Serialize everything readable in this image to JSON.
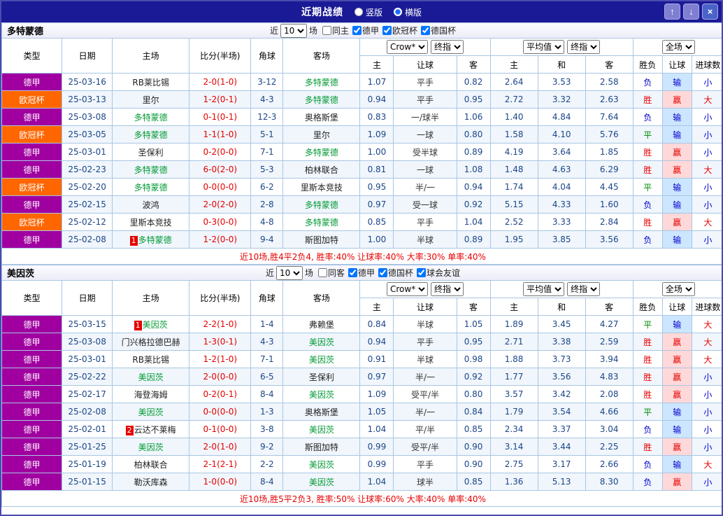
{
  "titlebar": {
    "title": "近期战绩",
    "vertical_label": "竖版",
    "horizontal_label": "横版",
    "up_icon": "↑",
    "down_icon": "↓",
    "close_icon": "×"
  },
  "table_header": {
    "type": "类型",
    "date": "日期",
    "home": "主场",
    "score": "比分(半场)",
    "corner": "角球",
    "away": "客场",
    "odds_select": "Crow*",
    "odds_final_select": "终指",
    "avg_select": "平均值",
    "avg_final_select": "终指",
    "scope_select": "全场",
    "sub": [
      "主",
      "让球",
      "客",
      "主",
      "和",
      "客",
      "胜负",
      "让球",
      "进球数"
    ]
  },
  "colors": {
    "league": {
      "德甲": "#A000A0",
      "欧冠杯": "#FF6600"
    },
    "result": {
      "胜": "#E60000",
      "平": "#008800",
      "负": "#0000CC"
    },
    "handicap_result": {
      "赢": {
        "fg": "#E60000",
        "bg": "#FFD9D9"
      },
      "输": {
        "fg": "#0000CC",
        "bg": "#CCE6FF"
      }
    },
    "goals": {
      "大": "#E60000",
      "小": "#0000CC"
    },
    "highlight_team": "#009933",
    "score": "#E60000"
  },
  "sections": [
    {
      "team": "多特蒙德",
      "filter": {
        "near": "近",
        "count": "10",
        "games": "场",
        "checkboxes": [
          {
            "label": "同主",
            "checked": false
          },
          {
            "label": "德甲",
            "checked": true
          },
          {
            "label": "欧冠杯",
            "checked": true
          },
          {
            "label": "德国杯",
            "checked": true
          }
        ]
      },
      "rows": [
        {
          "league": "德甲",
          "date": "25-03-16",
          "home": "RB莱比锡",
          "home_hl": false,
          "home_badge": "",
          "score": "2-0(1-0)",
          "corner": "3-12",
          "away": "多特蒙德",
          "away_hl": true,
          "away_badge": "",
          "odds": [
            "1.07",
            "平手",
            "0.82"
          ],
          "avg": [
            "2.64",
            "3.53",
            "2.58"
          ],
          "result": [
            "负",
            "输",
            "小"
          ]
        },
        {
          "league": "欧冠杯",
          "date": "25-03-13",
          "home": "里尔",
          "home_hl": false,
          "home_badge": "",
          "score": "1-2(0-1)",
          "corner": "4-3",
          "away": "多特蒙德",
          "away_hl": true,
          "away_badge": "",
          "odds": [
            "0.94",
            "平手",
            "0.95"
          ],
          "avg": [
            "2.72",
            "3.32",
            "2.63"
          ],
          "result": [
            "胜",
            "赢",
            "大"
          ]
        },
        {
          "league": "德甲",
          "date": "25-03-08",
          "home": "多特蒙德",
          "home_hl": true,
          "home_badge": "",
          "score": "0-1(0-1)",
          "corner": "12-3",
          "away": "奥格斯堡",
          "away_hl": false,
          "away_badge": "",
          "odds": [
            "0.83",
            "一/球半",
            "1.06"
          ],
          "avg": [
            "1.40",
            "4.84",
            "7.64"
          ],
          "result": [
            "负",
            "输",
            "小"
          ]
        },
        {
          "league": "欧冠杯",
          "date": "25-03-05",
          "home": "多特蒙德",
          "home_hl": true,
          "home_badge": "",
          "score": "1-1(1-0)",
          "corner": "5-1",
          "away": "里尔",
          "away_hl": false,
          "away_badge": "",
          "odds": [
            "1.09",
            "一球",
            "0.80"
          ],
          "avg": [
            "1.58",
            "4.10",
            "5.76"
          ],
          "result": [
            "平",
            "输",
            "小"
          ]
        },
        {
          "league": "德甲",
          "date": "25-03-01",
          "home": "圣保利",
          "home_hl": false,
          "home_badge": "",
          "score": "0-2(0-0)",
          "corner": "7-1",
          "away": "多特蒙德",
          "away_hl": true,
          "away_badge": "",
          "odds": [
            "1.00",
            "受半球",
            "0.89"
          ],
          "avg": [
            "4.19",
            "3.64",
            "1.85"
          ],
          "result": [
            "胜",
            "赢",
            "小"
          ]
        },
        {
          "league": "德甲",
          "date": "25-02-23",
          "home": "多特蒙德",
          "home_hl": true,
          "home_badge": "",
          "score": "6-0(2-0)",
          "corner": "5-3",
          "away": "柏林联合",
          "away_hl": false,
          "away_badge": "",
          "odds": [
            "0.81",
            "一球",
            "1.08"
          ],
          "avg": [
            "1.48",
            "4.63",
            "6.29"
          ],
          "result": [
            "胜",
            "赢",
            "大"
          ]
        },
        {
          "league": "欧冠杯",
          "date": "25-02-20",
          "home": "多特蒙德",
          "home_hl": true,
          "home_badge": "",
          "score": "0-0(0-0)",
          "corner": "6-2",
          "away": "里斯本竞技",
          "away_hl": false,
          "away_badge": "",
          "odds": [
            "0.95",
            "半/一",
            "0.94"
          ],
          "avg": [
            "1.74",
            "4.04",
            "4.45"
          ],
          "result": [
            "平",
            "输",
            "小"
          ]
        },
        {
          "league": "德甲",
          "date": "25-02-15",
          "home": "波鸿",
          "home_hl": false,
          "home_badge": "",
          "score": "2-0(2-0)",
          "corner": "2-8",
          "away": "多特蒙德",
          "away_hl": true,
          "away_badge": "",
          "odds": [
            "0.97",
            "受一球",
            "0.92"
          ],
          "avg": [
            "5.15",
            "4.33",
            "1.60"
          ],
          "result": [
            "负",
            "输",
            "小"
          ]
        },
        {
          "league": "欧冠杯",
          "date": "25-02-12",
          "home": "里斯本竞技",
          "home_hl": false,
          "home_badge": "",
          "score": "0-3(0-0)",
          "corner": "4-8",
          "away": "多特蒙德",
          "away_hl": true,
          "away_badge": "",
          "odds": [
            "0.85",
            "平手",
            "1.04"
          ],
          "avg": [
            "2.52",
            "3.33",
            "2.84"
          ],
          "result": [
            "胜",
            "赢",
            "大"
          ]
        },
        {
          "league": "德甲",
          "date": "25-02-08",
          "home": "多特蒙德",
          "home_hl": true,
          "home_badge": "1",
          "score": "1-2(0-0)",
          "corner": "9-4",
          "away": "斯图加特",
          "away_hl": false,
          "away_badge": "",
          "odds": [
            "1.00",
            "半球",
            "0.89"
          ],
          "avg": [
            "1.95",
            "3.85",
            "3.56"
          ],
          "result": [
            "负",
            "输",
            "小"
          ]
        }
      ],
      "summary": "近10场,胜4平2负4, 胜率:40% 让球率:40% 大率:30% 单率:40%"
    },
    {
      "team": "美因茨",
      "filter": {
        "near": "近",
        "count": "10",
        "games": "场",
        "checkboxes": [
          {
            "label": "同客",
            "checked": false
          },
          {
            "label": "德甲",
            "checked": true
          },
          {
            "label": "德国杯",
            "checked": true
          },
          {
            "label": "球会友谊",
            "checked": true
          }
        ]
      },
      "rows": [
        {
          "league": "德甲",
          "date": "25-03-15",
          "home": "美因茨",
          "home_hl": true,
          "home_badge": "1",
          "score": "2-2(1-0)",
          "corner": "1-4",
          "away": "弗赖堡",
          "away_hl": false,
          "away_badge": "",
          "odds": [
            "0.84",
            "半球",
            "1.05"
          ],
          "avg": [
            "1.89",
            "3.45",
            "4.27"
          ],
          "result": [
            "平",
            "输",
            "大"
          ]
        },
        {
          "league": "德甲",
          "date": "25-03-08",
          "home": "门兴格拉德巴赫",
          "home_hl": false,
          "home_badge": "",
          "score": "1-3(0-1)",
          "corner": "4-3",
          "away": "美因茨",
          "away_hl": true,
          "away_badge": "",
          "odds": [
            "0.94",
            "平手",
            "0.95"
          ],
          "avg": [
            "2.71",
            "3.38",
            "2.59"
          ],
          "result": [
            "胜",
            "赢",
            "大"
          ]
        },
        {
          "league": "德甲",
          "date": "25-03-01",
          "home": "RB莱比锡",
          "home_hl": false,
          "home_badge": "",
          "score": "1-2(1-0)",
          "corner": "7-1",
          "away": "美因茨",
          "away_hl": true,
          "away_badge": "",
          "odds": [
            "0.91",
            "半球",
            "0.98"
          ],
          "avg": [
            "1.88",
            "3.73",
            "3.94"
          ],
          "result": [
            "胜",
            "赢",
            "大"
          ]
        },
        {
          "league": "德甲",
          "date": "25-02-22",
          "home": "美因茨",
          "home_hl": true,
          "home_badge": "",
          "score": "2-0(0-0)",
          "corner": "6-5",
          "away": "圣保利",
          "away_hl": false,
          "away_badge": "",
          "odds": [
            "0.97",
            "半/一",
            "0.92"
          ],
          "avg": [
            "1.77",
            "3.56",
            "4.83"
          ],
          "result": [
            "胜",
            "赢",
            "小"
          ]
        },
        {
          "league": "德甲",
          "date": "25-02-17",
          "home": "海登海姆",
          "home_hl": false,
          "home_badge": "",
          "score": "0-2(0-1)",
          "corner": "8-4",
          "away": "美因茨",
          "away_hl": true,
          "away_badge": "",
          "odds": [
            "1.09",
            "受平/半",
            "0.80"
          ],
          "avg": [
            "3.57",
            "3.42",
            "2.08"
          ],
          "result": [
            "胜",
            "赢",
            "小"
          ]
        },
        {
          "league": "德甲",
          "date": "25-02-08",
          "home": "美因茨",
          "home_hl": true,
          "home_badge": "",
          "score": "0-0(0-0)",
          "corner": "1-3",
          "away": "奥格斯堡",
          "away_hl": false,
          "away_badge": "",
          "odds": [
            "1.05",
            "半/一",
            "0.84"
          ],
          "avg": [
            "1.79",
            "3.54",
            "4.66"
          ],
          "result": [
            "平",
            "输",
            "小"
          ]
        },
        {
          "league": "德甲",
          "date": "25-02-01",
          "home": "云达不莱梅",
          "home_hl": false,
          "home_badge": "2",
          "score": "0-1(0-0)",
          "corner": "3-8",
          "away": "美因茨",
          "away_hl": true,
          "away_badge": "",
          "odds": [
            "1.04",
            "平/半",
            "0.85"
          ],
          "avg": [
            "2.34",
            "3.37",
            "3.04"
          ],
          "result": [
            "负",
            "输",
            "小"
          ]
        },
        {
          "league": "德甲",
          "date": "25-01-25",
          "home": "美因茨",
          "home_hl": true,
          "home_badge": "",
          "score": "2-0(1-0)",
          "corner": "9-2",
          "away": "斯图加特",
          "away_hl": false,
          "away_badge": "",
          "odds": [
            "0.99",
            "受平/半",
            "0.90"
          ],
          "avg": [
            "3.14",
            "3.44",
            "2.25"
          ],
          "result": [
            "胜",
            "赢",
            "小"
          ]
        },
        {
          "league": "德甲",
          "date": "25-01-19",
          "home": "柏林联合",
          "home_hl": false,
          "home_badge": "",
          "score": "2-1(2-1)",
          "corner": "2-2",
          "away": "美因茨",
          "away_hl": true,
          "away_badge": "",
          "odds": [
            "0.99",
            "平手",
            "0.90"
          ],
          "avg": [
            "2.75",
            "3.17",
            "2.66"
          ],
          "result": [
            "负",
            "输",
            "大"
          ]
        },
        {
          "league": "德甲",
          "date": "25-01-15",
          "home": "勒沃库森",
          "home_hl": false,
          "home_badge": "",
          "score": "1-0(0-0)",
          "corner": "8-4",
          "away": "美因茨",
          "away_hl": true,
          "away_badge": "",
          "odds": [
            "1.04",
            "球半",
            "0.85"
          ],
          "avg": [
            "1.36",
            "5.13",
            "8.30"
          ],
          "result": [
            "负",
            "赢",
            "小"
          ]
        }
      ],
      "summary": "近10场,胜5平2负3, 胜率:50% 让球率:60% 大率:40% 单率:40%"
    }
  ]
}
